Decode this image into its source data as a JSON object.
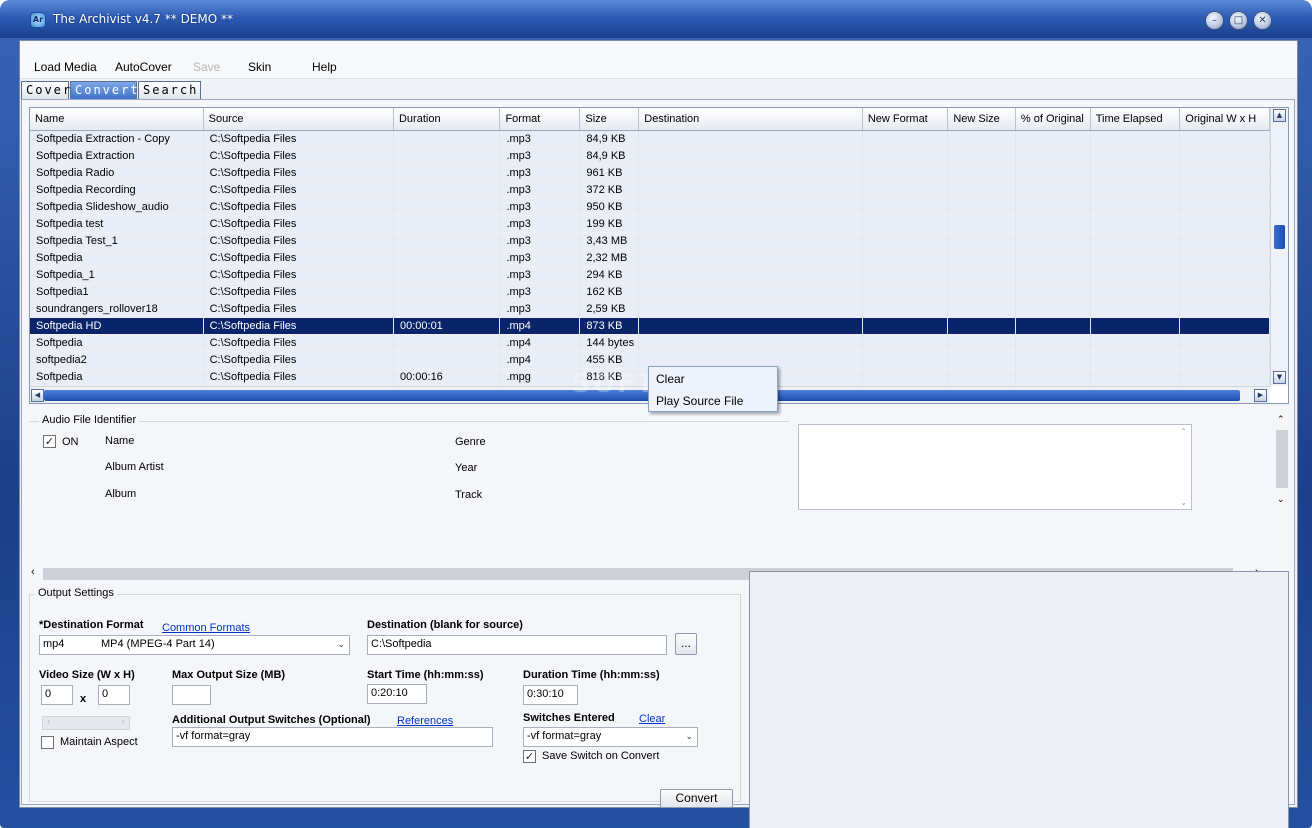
{
  "window": {
    "title": "The Archivist  v4.7 ** DEMO **",
    "icon_name": "app-icon",
    "buttons": [
      "minimize-icon",
      "maximize-icon",
      "close-icon"
    ],
    "accent": "#1c3f8a"
  },
  "menu": {
    "load_media": "Load Media",
    "autocover": "AutoCover",
    "save": "Save",
    "skin": "Skin",
    "help": "Help"
  },
  "tabs": [
    {
      "label": "Cover",
      "active": false
    },
    {
      "label": "Convert",
      "active": true
    },
    {
      "label": "Search",
      "active": false
    }
  ],
  "grid": {
    "columns": [
      "Name",
      "Source",
      "Duration",
      "Format",
      "Size",
      "Destination",
      "New Format",
      "New Size",
      "% of Original",
      "Time Elapsed",
      "Original W x H"
    ],
    "rows": [
      [
        "Softpedia Extraction - Copy",
        "C:\\Softpedia Files",
        "",
        ".mp3",
        "84,9 KB"
      ],
      [
        "Softpedia Extraction",
        "C:\\Softpedia Files",
        "",
        ".mp3",
        "84,9 KB"
      ],
      [
        "Softpedia Radio",
        "C:\\Softpedia Files",
        "",
        ".mp3",
        "961 KB"
      ],
      [
        "Softpedia Recording",
        "C:\\Softpedia Files",
        "",
        ".mp3",
        "372 KB"
      ],
      [
        "Softpedia Slideshow_audio",
        "C:\\Softpedia Files",
        "",
        ".mp3",
        "950 KB"
      ],
      [
        "Softpedia test",
        "C:\\Softpedia Files",
        "",
        ".mp3",
        "199 KB"
      ],
      [
        "Softpedia Test_1",
        "C:\\Softpedia Files",
        "",
        ".mp3",
        "3,43 MB"
      ],
      [
        "Softpedia",
        "C:\\Softpedia Files",
        "",
        ".mp3",
        "2,32 MB"
      ],
      [
        "Softpedia_1",
        "C:\\Softpedia Files",
        "",
        ".mp3",
        "294 KB"
      ],
      [
        "Softpedia1",
        "C:\\Softpedia Files",
        "",
        ".mp3",
        "162 KB"
      ],
      [
        "soundrangers_rollover18",
        "C:\\Softpedia Files",
        "",
        ".mp3",
        "2,59 KB"
      ],
      [
        "Softpedia HD",
        "C:\\Softpedia Files",
        "00:00:01",
        ".mp4",
        "873 KB"
      ],
      [
        "Softpedia",
        "C:\\Softpedia Files",
        "",
        ".mp4",
        "144 bytes"
      ],
      [
        "softpedia2",
        "C:\\Softpedia Files",
        "",
        ".mp4",
        "455 KB"
      ],
      [
        "Softpedia",
        "C:\\Softpedia Files",
        "00:00:16",
        ".mpg",
        "818 KB"
      ]
    ],
    "selected_row": 11,
    "selection_color": "#0a246a"
  },
  "context_menu": {
    "items": [
      "Clear",
      "Play Source File"
    ]
  },
  "watermark": "SOFTPEDIA",
  "audio_identifier": {
    "legend": "Audio File Identifier",
    "on_label": "ON",
    "on_checked": true,
    "name": "Name",
    "album_artist": "Album Artist",
    "album": "Album",
    "genre": "Genre",
    "year": "Year",
    "track": "Track"
  },
  "output": {
    "legend": "Output Settings",
    "dest_format_label": "*Destination Format",
    "common_formats_link": "Common Formats",
    "format_value": "mp4",
    "format_desc": "MP4 (MPEG-4 Part 14)",
    "destination_label": "Destination (blank for source)",
    "destination_value": "C:\\Softpedia",
    "browse_label": "...",
    "video_size_label": "Video Size (W x H)",
    "width": "0",
    "x_label": "x",
    "height": "0",
    "maintain_aspect": "Maintain Aspect",
    "maintain_checked": false,
    "max_size_label": "Max Output Size (MB)",
    "max_size_value": "",
    "start_time_label": "Start Time (hh:mm:ss)",
    "start_time_value": "0:20:10",
    "duration_label": "Duration Time (hh:mm:ss)",
    "duration_value": "0:30:10",
    "switches_label": "Additional Output Switches (Optional)",
    "references_link": "References",
    "switches_value": "-vf format=gray",
    "entered_label": "Switches Entered",
    "clear_link": "Clear",
    "entered_value": "-vf format=gray",
    "save_switch_label": "Save Switch on Convert",
    "save_switch_checked": true,
    "convert_button": "Convert"
  }
}
